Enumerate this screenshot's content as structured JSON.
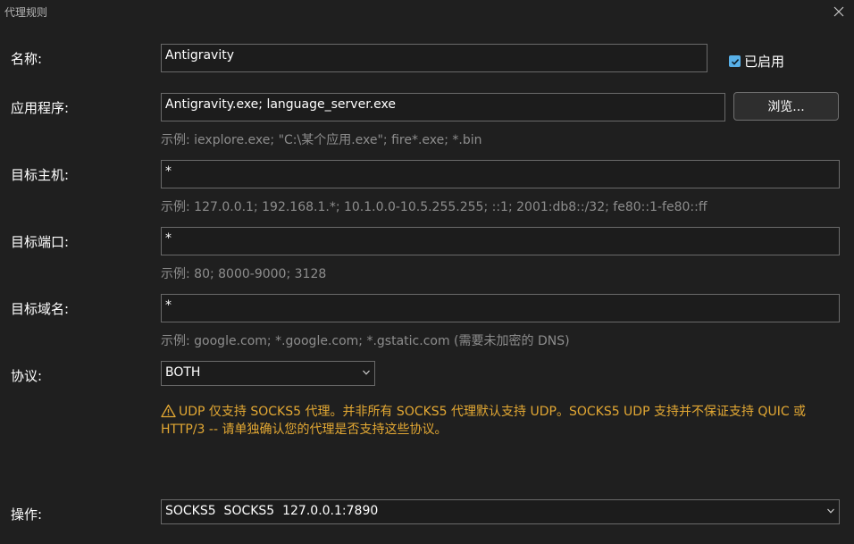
{
  "window": {
    "title": "代理规则"
  },
  "form": {
    "name": {
      "label": "名称:",
      "value": "Antigravity",
      "enabled_label": "已启用",
      "enabled": true
    },
    "applications": {
      "label": "应用程序:",
      "value": "Antigravity.exe; language_server.exe",
      "browse_label": "浏览...",
      "hint": "示例: iexplore.exe; \"C:\\某个应用.exe\"; fire*.exe; *.bin"
    },
    "target_hosts": {
      "label": "目标主机:",
      "value": "*",
      "hint": "示例: 127.0.0.1; 192.168.1.*; 10.1.0.0-10.5.255.255; ::1; 2001:db8::/32; fe80::1-fe80::ff"
    },
    "target_ports": {
      "label": "目标端口:",
      "value": "*",
      "hint": "示例: 80; 8000-9000; 3128"
    },
    "target_domains": {
      "label": "目标域名:",
      "value": "*",
      "hint": "示例: google.com; *.google.com; *.gstatic.com (需要未加密的 DNS)"
    },
    "protocol": {
      "label": "协议:",
      "selected": "BOTH",
      "warning": "UDP 仅支持 SOCKS5 代理。并非所有 SOCKS5 代理默认支持 UDP。SOCKS5 UDP 支持并不保证支持 QUIC 或 HTTP/3 -- 请单独确认您的代理是否支持这些协议。"
    },
    "action": {
      "label": "操作:",
      "selected": "SOCKS5  SOCKS5  127.0.0.1:7890"
    }
  },
  "icons": {
    "close": "close-icon",
    "checkbox": "checkmark-icon",
    "dropdown": "chevron-down-icon",
    "warning": "warning-triangle-icon"
  },
  "colors": {
    "background": "#1f1f1f",
    "field_border": "#6a6a6a",
    "hint_text": "#8d8d8d",
    "warning_text": "#e3a833",
    "checkbox_accent": "#58b0e8"
  }
}
